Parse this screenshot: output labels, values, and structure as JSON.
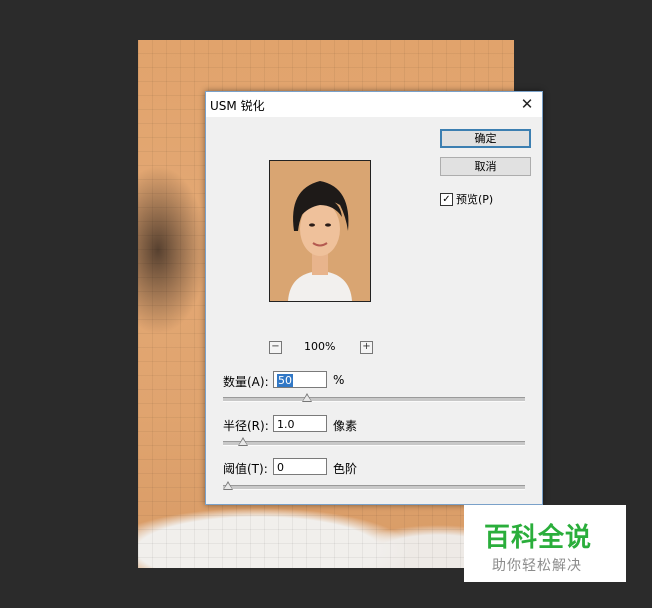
{
  "dialog": {
    "title": "USM 锐化",
    "close_label": "✕",
    "ok_label": "确定",
    "cancel_label": "取消",
    "preview_label": "预览(P)",
    "preview_checked": true,
    "zoom": {
      "minus": "−",
      "value": "100%",
      "plus": "+"
    },
    "amount": {
      "label": "数量(A):",
      "value": "50",
      "unit": "%",
      "slider_fraction": 0.27
    },
    "radius": {
      "label": "半径(R):",
      "value": "1.0",
      "unit": "像素",
      "slider_fraction": 0.05
    },
    "threshold": {
      "label": "阈值(T):",
      "value": "0",
      "unit": "色阶",
      "slider_fraction": 0.0
    }
  },
  "watermark": {
    "title": "百科全说",
    "subtitle": "助你轻松解决"
  },
  "colors": {
    "accent": "#3c7fb1",
    "watermark_green": "#2aae3b",
    "background": "#2b2b2b"
  }
}
